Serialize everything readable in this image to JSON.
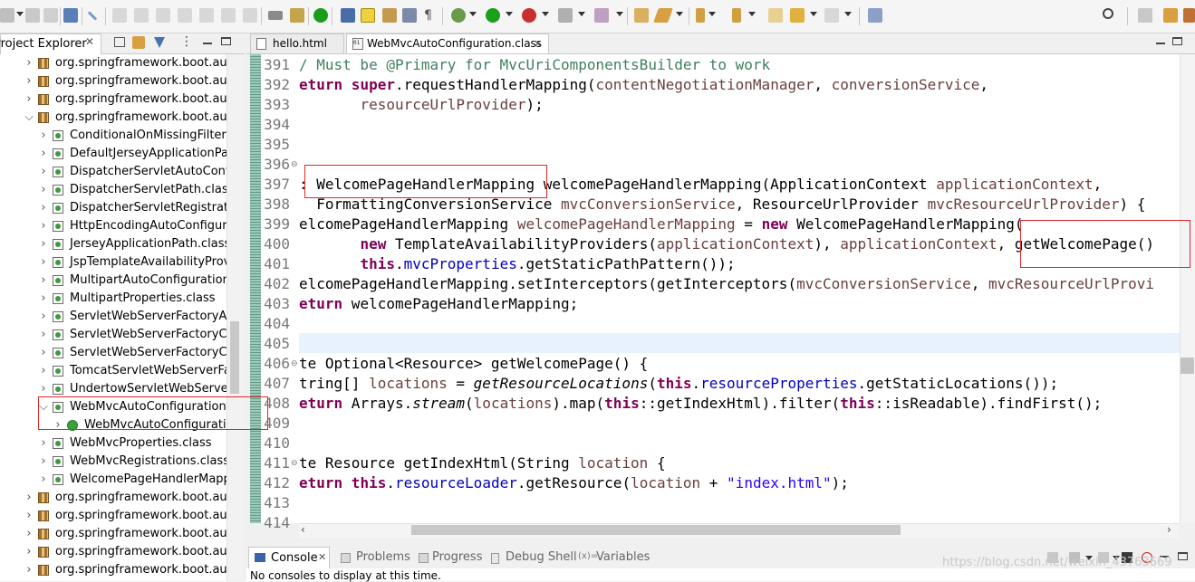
{
  "project_explorer": {
    "title": "Project Explorer",
    "tree": [
      {
        "label": "org.springframework.boot.autoc",
        "kind": "package",
        "depth": 0,
        "expanded": false
      },
      {
        "label": "org.springframework.boot.autoc",
        "kind": "package",
        "depth": 0,
        "expanded": false
      },
      {
        "label": "org.springframework.boot.autoc",
        "kind": "package",
        "depth": 0,
        "expanded": false
      },
      {
        "label": "org.springframework.boot.autoc",
        "kind": "package",
        "depth": 0,
        "expanded": true
      },
      {
        "label": "ConditionalOnMissingFilterBe",
        "kind": "class",
        "depth": 1,
        "expanded": false
      },
      {
        "label": "DefaultJerseyApplicationPath.",
        "kind": "class",
        "depth": 1,
        "expanded": false
      },
      {
        "label": "DispatcherServletAutoConfigu",
        "kind": "class",
        "depth": 1,
        "expanded": false
      },
      {
        "label": "DispatcherServletPath.class",
        "kind": "class",
        "depth": 1,
        "expanded": false
      },
      {
        "label": "DispatcherServletRegistration",
        "kind": "class",
        "depth": 1,
        "expanded": false
      },
      {
        "label": "HttpEncodingAutoConfigurati",
        "kind": "class",
        "depth": 1,
        "expanded": false
      },
      {
        "label": "JerseyApplicationPath.class",
        "kind": "class",
        "depth": 1,
        "expanded": false
      },
      {
        "label": "JspTemplateAvailabilityProvid",
        "kind": "class",
        "depth": 1,
        "expanded": false
      },
      {
        "label": "MultipartAutoConfiguration.cl",
        "kind": "class",
        "depth": 1,
        "expanded": false
      },
      {
        "label": "MultipartProperties.class",
        "kind": "class",
        "depth": 1,
        "expanded": false
      },
      {
        "label": "ServletWebServerFactoryAuto",
        "kind": "class",
        "depth": 1,
        "expanded": false
      },
      {
        "label": "ServletWebServerFactoryConf",
        "kind": "class",
        "depth": 1,
        "expanded": false
      },
      {
        "label": "ServletWebServerFactoryCusto",
        "kind": "class",
        "depth": 1,
        "expanded": false
      },
      {
        "label": "TomcatServletWebServerFacto",
        "kind": "class",
        "depth": 1,
        "expanded": false
      },
      {
        "label": "UndertowServletWebServerFa",
        "kind": "class",
        "depth": 1,
        "expanded": false
      },
      {
        "label": "WebMvcAutoConfiguration.cla",
        "kind": "class",
        "depth": 1,
        "expanded": true
      },
      {
        "label": "WebMvcAutoConfiguration",
        "kind": "inner",
        "depth": 2,
        "expanded": false
      },
      {
        "label": "WebMvcProperties.class",
        "kind": "class",
        "depth": 1,
        "expanded": false
      },
      {
        "label": "WebMvcRegistrations.class",
        "kind": "class",
        "depth": 1,
        "expanded": false
      },
      {
        "label": "WelcomePageHandlerMappin",
        "kind": "class",
        "depth": 1,
        "expanded": false
      },
      {
        "label": "org.springframework.boot.autoc",
        "kind": "package",
        "depth": 0,
        "expanded": false
      },
      {
        "label": "org.springframework.boot.autoc",
        "kind": "package",
        "depth": 0,
        "expanded": false
      },
      {
        "label": "org.springframework.boot.autoc",
        "kind": "package",
        "depth": 0,
        "expanded": false
      },
      {
        "label": "org.springframework.boot.autoc",
        "kind": "package",
        "depth": 0,
        "expanded": false
      },
      {
        "label": "org.springframework.boot.autoc",
        "kind": "package",
        "depth": 0,
        "expanded": false
      }
    ]
  },
  "editor": {
    "tabs": [
      {
        "label": "hello.html",
        "active": false
      },
      {
        "label": "WebMvcAutoConfiguration.class",
        "active": true
      }
    ],
    "lines": [
      {
        "n": "391",
        "fold": "",
        "tokens": [
          [
            "c",
            "/ Must be @Primary for MvcUriComponentsBuilder to work"
          ]
        ]
      },
      {
        "n": "392",
        "fold": "",
        "tokens": [
          [
            "k",
            "eturn"
          ],
          [
            "",
            ""
          ],
          [
            "",
            ""
          ],
          [
            "",
            ""
          ],
          [
            "k",
            " super"
          ],
          [
            "",
            "."
          ],
          [
            "",
            "requestHandlerMapping("
          ],
          [
            "p",
            "contentNegotiationManager"
          ],
          [
            "",
            ", "
          ],
          [
            "p",
            "conversionService"
          ],
          [
            "",
            ","
          ]
        ]
      },
      {
        "n": "393",
        "fold": "",
        "tokens": [
          [
            "",
            "       "
          ],
          [
            "p",
            "resourceUrlProvider"
          ],
          [
            "",
            ");"
          ]
        ]
      },
      {
        "n": "394",
        "fold": "",
        "tokens": []
      },
      {
        "n": "395",
        "fold": "",
        "tokens": []
      },
      {
        "n": "396",
        "fold": "⊖",
        "tokens": []
      },
      {
        "n": "397",
        "fold": "",
        "tokens": [
          [
            "",
            ": WelcomePageHandlerMapping welcomePageHandlerMapping(ApplicationContext "
          ],
          [
            "p",
            "applicationContext"
          ],
          [
            "",
            ","
          ]
        ]
      },
      {
        "n": "398",
        "fold": "",
        "tokens": [
          [
            "",
            "  FormattingConversionService "
          ],
          [
            "p",
            "mvcConversionService"
          ],
          [
            "",
            ", ResourceUrlProvider "
          ],
          [
            "p",
            "mvcResourceUrlProvider"
          ],
          [
            "",
            ") {"
          ]
        ]
      },
      {
        "n": "399",
        "fold": "",
        "tokens": [
          [
            "",
            "elcomePageHandlerMapping "
          ],
          [
            "p",
            "welcomePageHandlerMapping"
          ],
          [
            "",
            " = "
          ],
          [
            "k",
            "new"
          ],
          [
            "",
            " WelcomePageHandlerMapping("
          ]
        ]
      },
      {
        "n": "400",
        "fold": "",
        "tokens": [
          [
            "",
            "       "
          ],
          [
            "k",
            "new"
          ],
          [
            "",
            " TemplateAvailabilityProviders("
          ],
          [
            "p",
            "applicationContext"
          ],
          [
            "",
            "), "
          ],
          [
            "p",
            "applicationContext"
          ],
          [
            "",
            ", getWelcomePage()"
          ]
        ]
      },
      {
        "n": "401",
        "fold": "",
        "tokens": [
          [
            "",
            "       "
          ],
          [
            "k",
            "this"
          ],
          [
            "",
            "."
          ],
          [
            "f",
            "mvcProperties"
          ],
          [
            "",
            ".getStaticPathPattern());"
          ]
        ]
      },
      {
        "n": "402",
        "fold": "",
        "tokens": [
          [
            "",
            "elcomePageHandlerMapping.setInterceptors(getInterceptors("
          ],
          [
            "p",
            "mvcConversionService"
          ],
          [
            "",
            ", "
          ],
          [
            "p",
            "mvcResourceUrlProvi"
          ]
        ]
      },
      {
        "n": "403",
        "fold": "",
        "tokens": [
          [
            "k",
            "eturn"
          ],
          [
            "",
            ""
          ],
          [
            "",
            " welcomePageHandlerMapping;"
          ]
        ]
      },
      {
        "n": "404",
        "fold": "",
        "tokens": []
      },
      {
        "n": "405",
        "fold": "",
        "tokens": []
      },
      {
        "n": "406",
        "fold": "⊖",
        "tokens": [
          [
            "",
            "te Optional<Resource> getWelcomePage() {"
          ]
        ]
      },
      {
        "n": "407",
        "fold": "",
        "tokens": [
          [
            "",
            "tring[] "
          ],
          [
            "p",
            "locations"
          ],
          [
            "",
            " = "
          ],
          [
            "i",
            "getResourceLocations"
          ],
          [
            "",
            "("
          ],
          [
            "k",
            "this"
          ],
          [
            "",
            "."
          ],
          [
            "f",
            "resourceProperties"
          ],
          [
            "",
            ".getStaticLocations());"
          ]
        ]
      },
      {
        "n": "408",
        "fold": "",
        "tokens": [
          [
            "k",
            "eturn"
          ],
          [
            "",
            " Arrays."
          ],
          [
            "i",
            "stream"
          ],
          [
            "",
            "("
          ],
          [
            "p",
            "locations"
          ],
          [
            "",
            ").map("
          ],
          [
            "k",
            "this"
          ],
          [
            "",
            "::getIndexHtml).filter("
          ],
          [
            "k",
            "this"
          ],
          [
            "",
            "::isReadable).findFirst();"
          ]
        ]
      },
      {
        "n": "409",
        "fold": "",
        "tokens": []
      },
      {
        "n": "410",
        "fold": "",
        "tokens": []
      },
      {
        "n": "411",
        "fold": "⊖",
        "tokens": [
          [
            "",
            "te Resource getIndexHtml(String "
          ],
          [
            "p",
            "location"
          ],
          [
            "",
            " {"
          ]
        ]
      },
      {
        "n": "412",
        "fold": "",
        "tokens": [
          [
            "k",
            "eturn"
          ],
          [
            "",
            ""
          ],
          [
            "k",
            " this"
          ],
          [
            "",
            "."
          ],
          [
            "f",
            "resourceLoader"
          ],
          [
            "",
            ".getResource("
          ],
          [
            "p",
            "location"
          ],
          [
            "",
            " + "
          ],
          [
            "s",
            "\"index.html\""
          ],
          [
            "",
            ");"
          ]
        ]
      },
      {
        "n": "413",
        "fold": "",
        "tokens": []
      },
      {
        "n": "414",
        "fold": "",
        "tokens": []
      }
    ]
  },
  "console": {
    "tabs": [
      "Console",
      "Problems",
      "Progress",
      "Debug Shell",
      "Variables"
    ],
    "message": "No consoles to display at this time."
  },
  "watermark": "https://blog.csdn.net/weixin_43763669",
  "colors": {
    "annotation_box": "#e4252c",
    "keyword": "#7f0055",
    "field": "#0000c0",
    "param": "#6a3e3e",
    "comment": "#3f7f5f",
    "string": "#2a00ff"
  }
}
